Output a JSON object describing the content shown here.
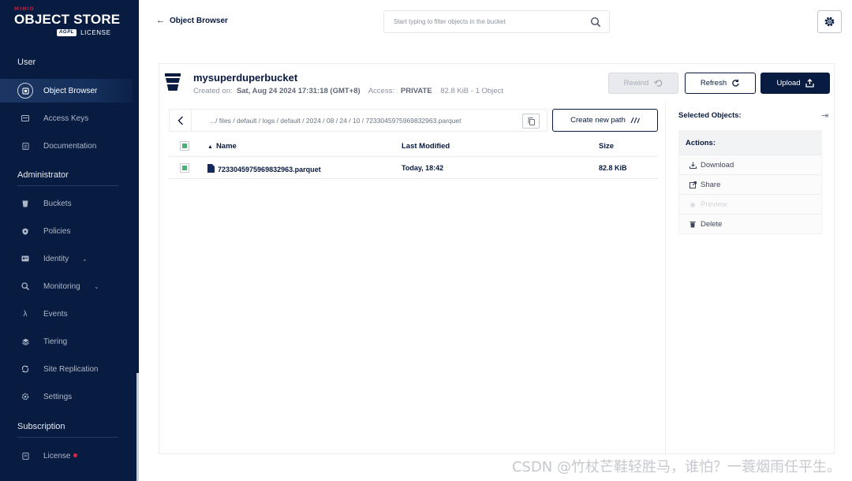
{
  "sidebar": {
    "logo": {
      "brand": "MINIO",
      "product": "OBJECT STORE",
      "badge": "AGPL",
      "license": "LICENSE"
    },
    "sections": [
      {
        "title": "User"
      },
      {
        "title": "Administrator"
      },
      {
        "title": "Subscription"
      }
    ],
    "items": [
      {
        "label": "Object Browser",
        "icon": "folder-icon",
        "active": true
      },
      {
        "label": "Access Keys",
        "icon": "key-icon"
      },
      {
        "label": "Documentation",
        "icon": "document-icon"
      },
      {
        "label": "Buckets",
        "icon": "bucket-icon"
      },
      {
        "label": "Policies",
        "icon": "shield-icon"
      },
      {
        "label": "Identity",
        "icon": "identity-icon",
        "expandable": true
      },
      {
        "label": "Monitoring",
        "icon": "monitor-icon",
        "expandable": true
      },
      {
        "label": "Events",
        "icon": "lambda-icon"
      },
      {
        "label": "Tiering",
        "icon": "tiers-icon"
      },
      {
        "label": "Site Replication",
        "icon": "replication-icon"
      },
      {
        "label": "Settings",
        "icon": "settings-icon"
      },
      {
        "label": "License",
        "icon": "license-icon",
        "alert": true
      }
    ]
  },
  "topbar": {
    "title": "Object Browser",
    "search_placeholder": "Start typing to filter objects in the bucket"
  },
  "bucket": {
    "name": "mysuperduperbucket",
    "created_label": "Created on:",
    "created_value": "Sat, Aug 24 2024 17:31:18 (GMT+8)",
    "access_label": "Access:",
    "access_value": "PRIVATE",
    "usage": "82.8 KiB - 1 Object"
  },
  "buttons": {
    "rewind": "Rewind",
    "refresh": "Refresh",
    "upload": "Upload",
    "create_path": "Create new path"
  },
  "breadcrumb": {
    "path": ".../ files / default / logs / default / 2024 / 08 / 24 / 10 / 7233045975969832963.parquet"
  },
  "table": {
    "headers": {
      "name": "Name",
      "modified": "Last Modified",
      "size": "Size"
    },
    "rows": [
      {
        "name": "7233045975969832963.parquet",
        "modified": "Today, 18:42",
        "size": "82.8 KiB"
      }
    ]
  },
  "selection": {
    "title": "Selected Objects:",
    "actions_title": "Actions:",
    "actions": [
      {
        "label": "Download",
        "icon": "download-icon",
        "enabled": true
      },
      {
        "label": "Share",
        "icon": "share-icon",
        "enabled": true
      },
      {
        "label": "Preview",
        "icon": "preview-icon",
        "enabled": false
      },
      {
        "label": "Delete",
        "icon": "trash-icon",
        "enabled": true
      }
    ]
  },
  "watermark": "CSDN @竹杖芒鞋轻胜马，谁怕？一蓑烟雨任平生。",
  "colors": {
    "navy": "#081c42",
    "accent_red": "#c51b3b",
    "check_green": "#4caf77"
  }
}
